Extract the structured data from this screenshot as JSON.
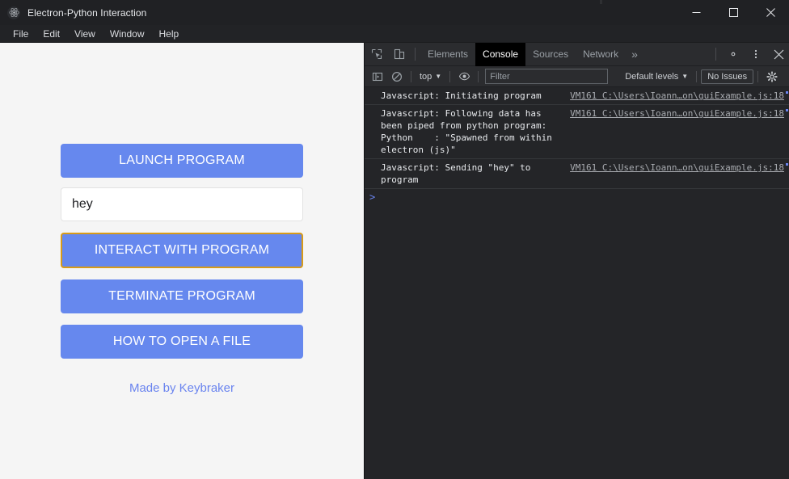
{
  "window": {
    "title": "Electron-Python Interaction",
    "app_icon": "electron-atom-icon",
    "controls": {
      "minimize": "minimize-icon",
      "maximize": "maximize-icon",
      "close": "close-icon"
    }
  },
  "menubar": {
    "items": [
      {
        "label": "File"
      },
      {
        "label": "Edit"
      },
      {
        "label": "View"
      },
      {
        "label": "Window"
      },
      {
        "label": "Help"
      }
    ]
  },
  "renderer": {
    "launch_button": "LAUNCH PROGRAM",
    "input": {
      "value": "hey",
      "placeholder": ""
    },
    "interact_button": "INTERACT WITH PROGRAM",
    "terminate_button": "TERMINATE PROGRAM",
    "howto_button": "HOW TO OPEN A FILE",
    "credit_link": "Made by Keybraker"
  },
  "devtools": {
    "toolbar_icons": {
      "inspect": "inspect-element-icon",
      "device": "device-toolbar-icon",
      "settings": "gear-icon",
      "more": "more-vertical-icon",
      "close": "close-icon"
    },
    "tabs": [
      {
        "label": "Elements",
        "active": false
      },
      {
        "label": "Console",
        "active": true
      },
      {
        "label": "Sources",
        "active": false
      },
      {
        "label": "Network",
        "active": false
      }
    ],
    "more_tabs": "»",
    "filterbar": {
      "sidebar_icon": "console-sidebar-icon",
      "clear_icon": "clear-console-icon",
      "context": "top",
      "eye_icon": "live-expression-eye-icon",
      "filter_placeholder": "Filter",
      "filter_value": "",
      "levels": "Default levels",
      "issues": "No Issues",
      "settings_icon": "gear-icon"
    },
    "messages": [
      {
        "text": "Javascript: Initiating program",
        "source": "VM161 C:\\Users\\Ioann…on\\guiExample.js:18"
      },
      {
        "text": "Javascript: Following data has been piped from python program: Python    : \"Spawned from within electron (js)\"",
        "source": "VM161 C:\\Users\\Ioann…on\\guiExample.js:18"
      },
      {
        "text": "Javascript: Sending \"hey\" to program",
        "source": "VM161 C:\\Users\\Ioann…on\\guiExample.js:18"
      }
    ],
    "prompt": {
      "chevron": ">",
      "value": ""
    }
  },
  "colors": {
    "button_blue": "#6688ee",
    "focus_ring": "#d89b18",
    "link_blue": "#6a84ef",
    "renderer_bg": "#f5f5f5",
    "devtools_bg": "#242528",
    "chrome_bg": "#202124"
  }
}
